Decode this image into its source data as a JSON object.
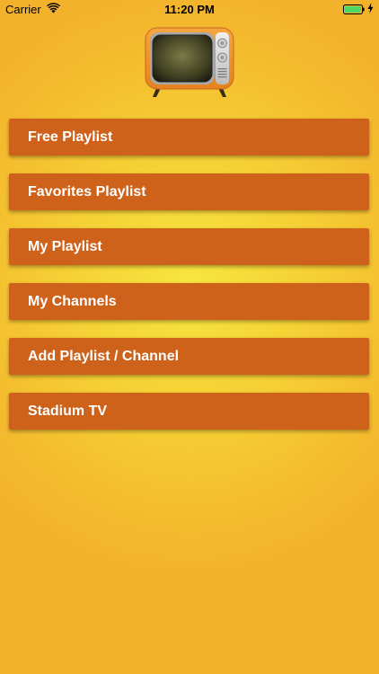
{
  "status_bar": {
    "carrier": "Carrier",
    "time": "11:20 PM",
    "battery_color": "#4cd964"
  },
  "logo": {
    "icon": "retro-tv-icon"
  },
  "menu": {
    "items": [
      {
        "label": "Free Playlist"
      },
      {
        "label": "Favorites Playlist"
      },
      {
        "label": "My Playlist"
      },
      {
        "label": "My Channels"
      },
      {
        "label": "Add Playlist / Channel"
      },
      {
        "label": "Stadium TV"
      }
    ]
  },
  "colors": {
    "button_bg": "#cf621b",
    "button_text": "#ffffff",
    "background_center": "#f7e63f",
    "background_edge": "#f3b22c"
  }
}
